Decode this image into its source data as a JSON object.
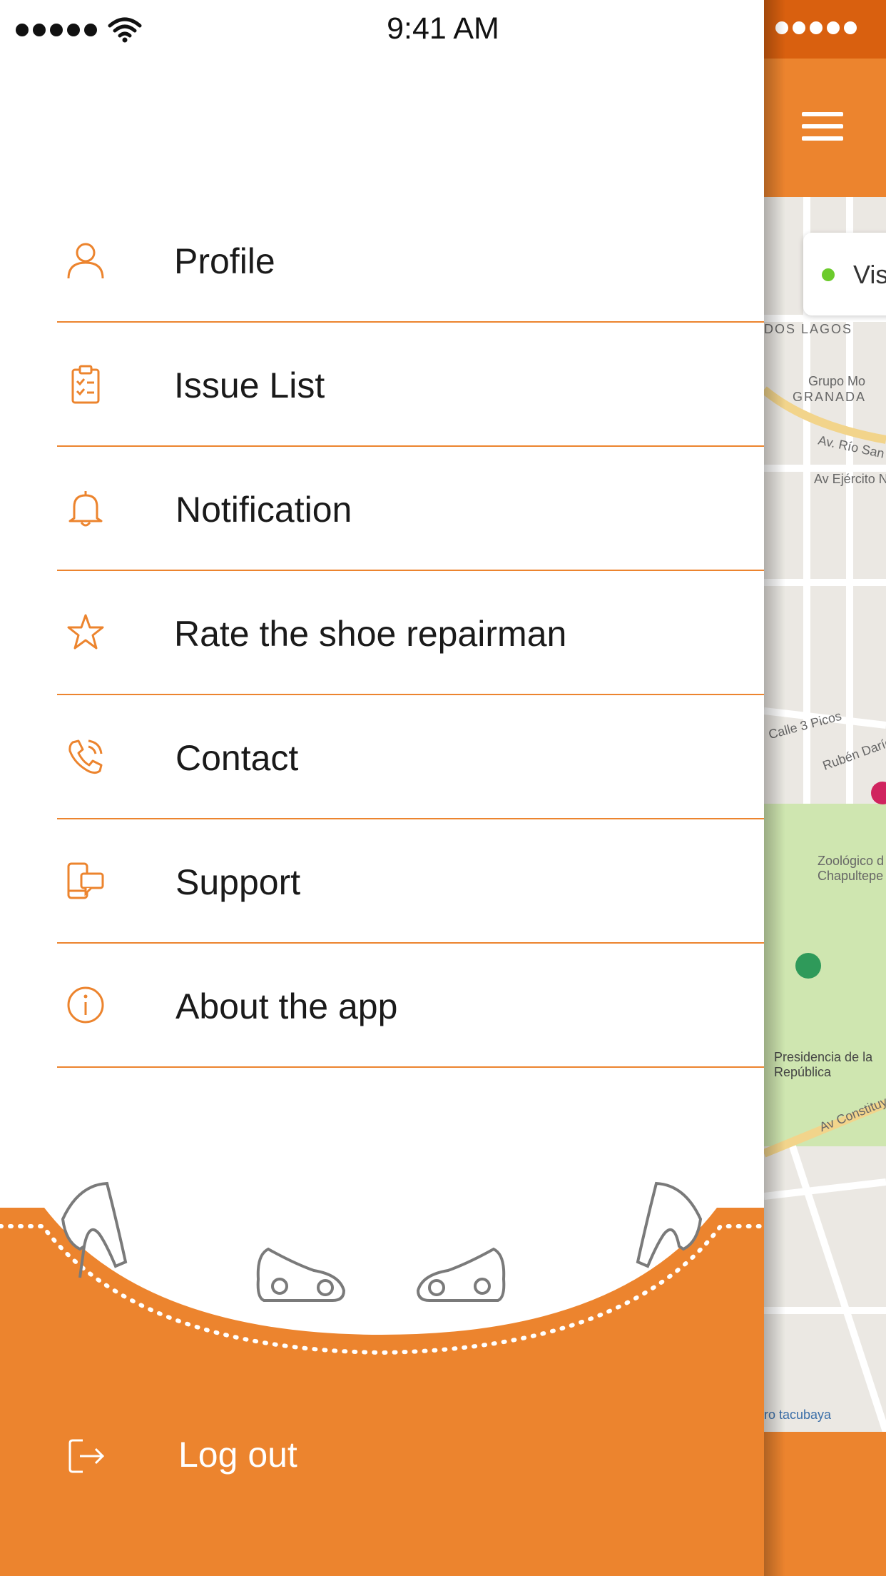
{
  "status_bar": {
    "time": "9:41 AM"
  },
  "menu": {
    "items": [
      {
        "label": "Profile",
        "icon": "person-icon"
      },
      {
        "label": "Issue List",
        "icon": "clipboard-checklist-icon"
      },
      {
        "label": "Notification",
        "icon": "bell-icon"
      },
      {
        "label": "Rate the shoe repairman",
        "icon": "star-icon"
      },
      {
        "label": "Contact",
        "icon": "phone-icon"
      },
      {
        "label": "Support",
        "icon": "devices-chat-icon"
      },
      {
        "label": "About the app",
        "icon": "info-icon"
      }
    ],
    "logout_label": "Log out"
  },
  "background_app": {
    "chip_text": "Vis",
    "map_labels": {
      "dos_lagos": "DOS LAGOS",
      "grupo": "Grupo Mo",
      "granada": "GRANADA",
      "rio": "Av. Río San",
      "ejercito": "Av Ejército N",
      "calle_picos": "Calle 3 Picos",
      "ruben": "Rubén Darío",
      "zoo": "Zoológico d Chapultepe",
      "presidencia": "Presidencia de la República",
      "constitu": "Av Constituy",
      "tacubaya": "ro tacubaya"
    }
  },
  "colors": {
    "accent": "#ec842e",
    "dark_accent": "#d9600f",
    "text": "#1a1a1a",
    "online": "#6ccb2c"
  }
}
